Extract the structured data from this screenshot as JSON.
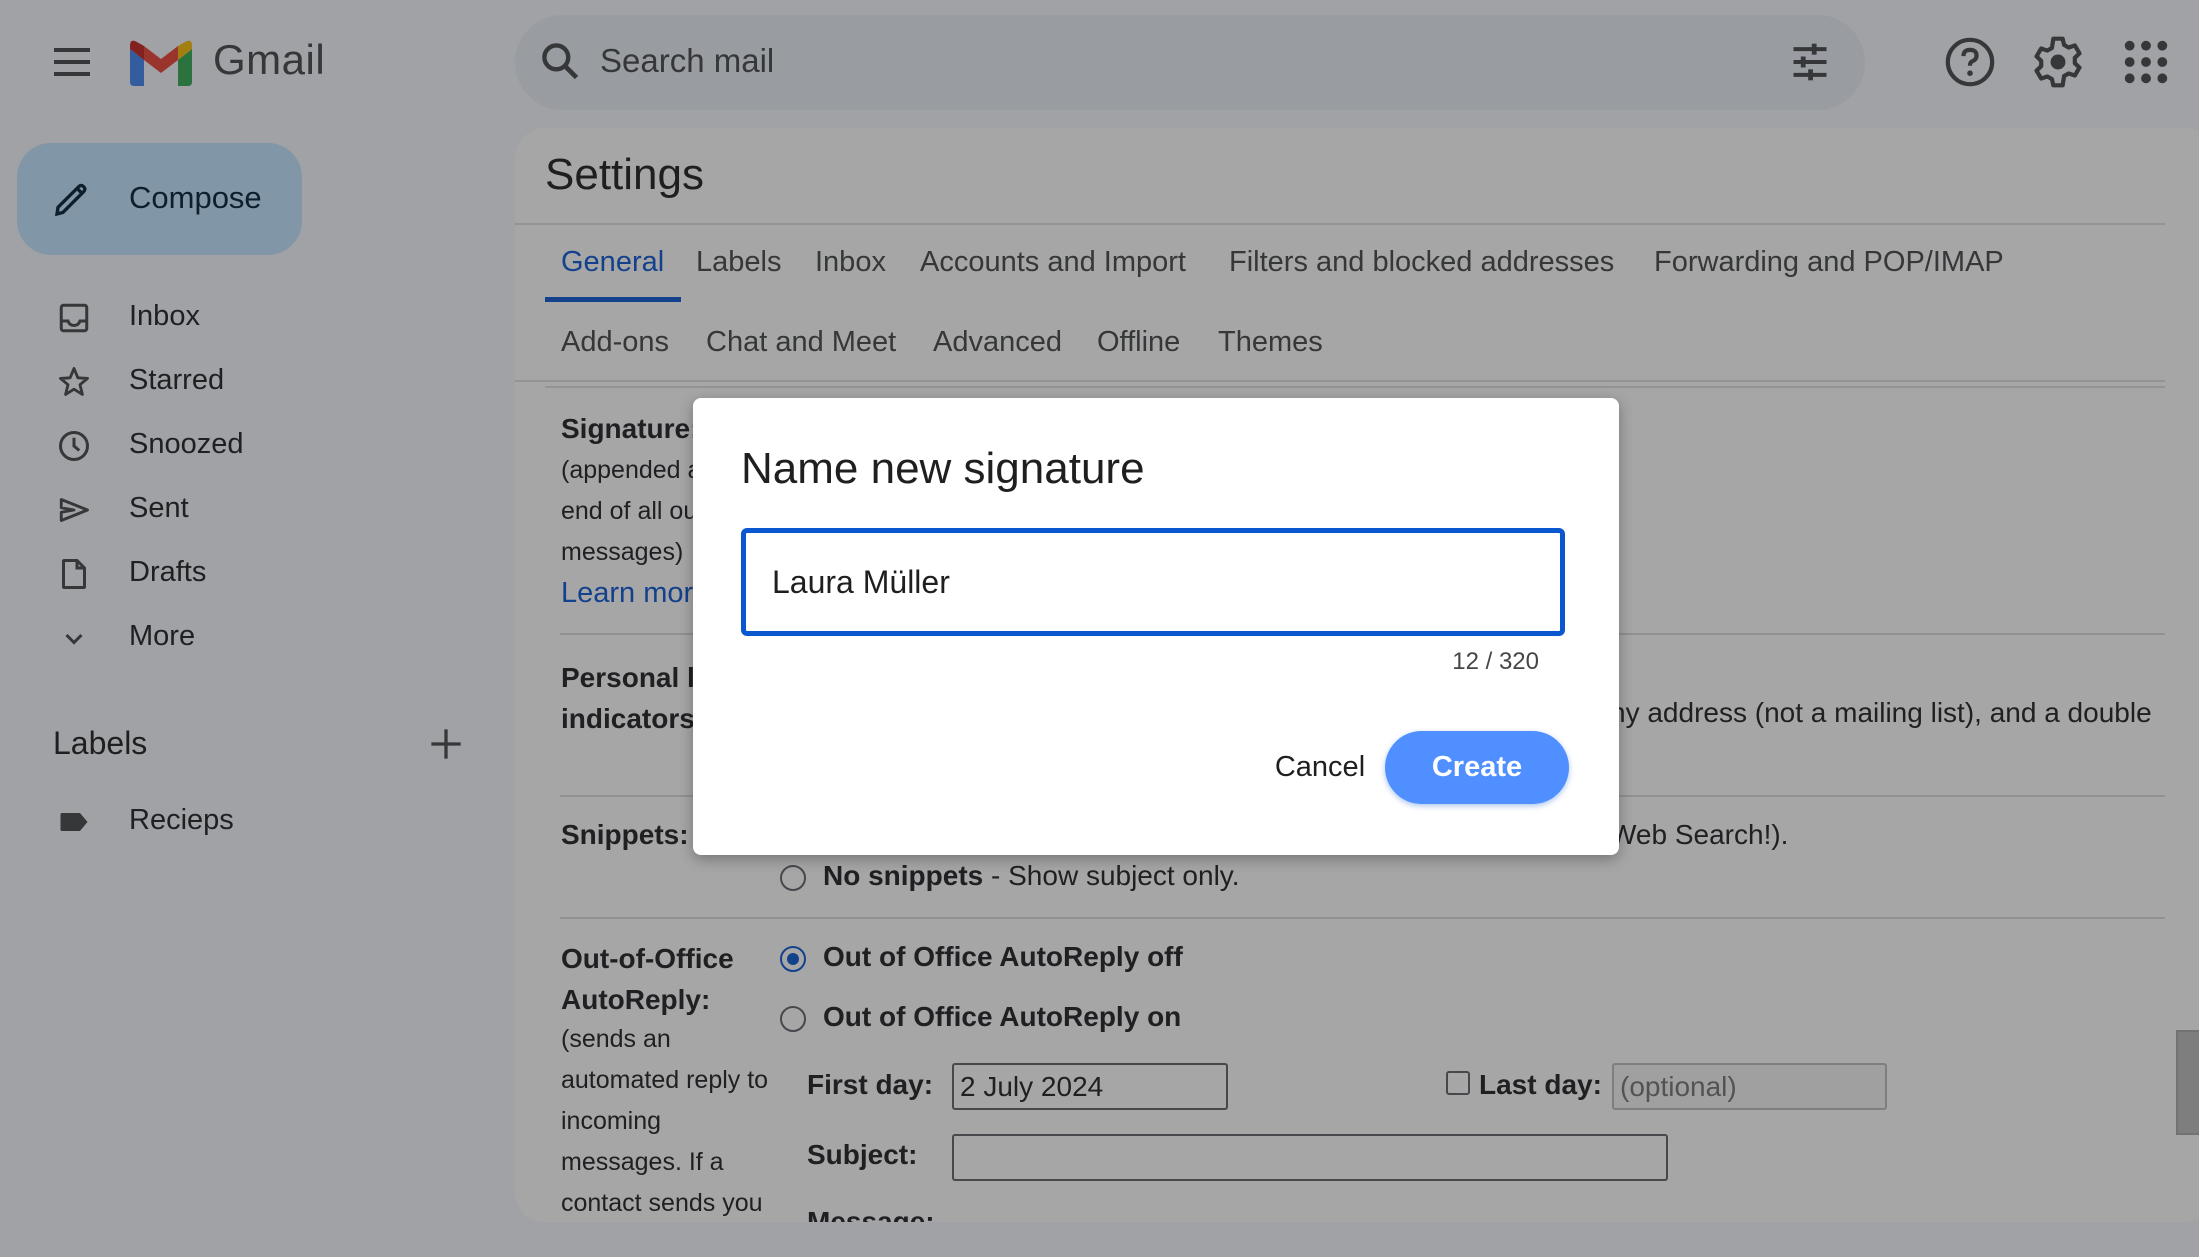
{
  "app": {
    "brand": "Gmail"
  },
  "header": {
    "search_placeholder": "Search mail",
    "icons": [
      "menu-icon",
      "search-icon",
      "search-options-icon",
      "help-icon",
      "settings-gear-icon",
      "apps-grid-icon"
    ]
  },
  "sidebar": {
    "compose_label": "Compose",
    "items": [
      {
        "label": "Inbox",
        "icon": "inbox-icon"
      },
      {
        "label": "Starred",
        "icon": "star-icon"
      },
      {
        "label": "Snoozed",
        "icon": "clock-icon"
      },
      {
        "label": "Sent",
        "icon": "send-icon"
      },
      {
        "label": "Drafts",
        "icon": "draft-icon"
      },
      {
        "label": "More",
        "icon": "chevron-down-icon"
      }
    ],
    "labels_heading": "Labels",
    "labels": [
      {
        "label": "Recieps",
        "icon": "label-icon"
      }
    ]
  },
  "settings": {
    "title": "Settings",
    "tabs_row1": [
      {
        "label": "General",
        "active": true
      },
      {
        "label": "Labels"
      },
      {
        "label": "Inbox"
      },
      {
        "label": "Accounts and Import"
      },
      {
        "label": "Filters and blocked addresses"
      },
      {
        "label": "Forwarding and POP/IMAP"
      }
    ],
    "tabs_row2": [
      {
        "label": "Add-ons"
      },
      {
        "label": "Chat and Meet"
      },
      {
        "label": "Advanced"
      },
      {
        "label": "Offline"
      },
      {
        "label": "Themes"
      }
    ],
    "signature": {
      "label": "Signature:",
      "sub_lines": [
        "(appended at the",
        "end of all outgoing",
        "messages)"
      ],
      "learn_more": "Learn more"
    },
    "personal_indicators": {
      "label_lines": [
        "Personal level",
        "indicators:"
      ],
      "text_visible": "ny address (not a mailing list), and a double"
    },
    "snippets": {
      "label": "Snippets:",
      "text_visible": "Web Search!).",
      "no_snippets_bold": "No snippets",
      "no_snippets_desc": " - Show subject only.",
      "no_snippets_selected": false
    },
    "out_of_office": {
      "label_lines": [
        "Out-of-Office",
        "AutoReply:"
      ],
      "sub_lines": [
        "(sends an",
        "automated reply to",
        "incoming",
        "messages. If a",
        "contact sends you"
      ],
      "option_off": "Out of Office AutoReply off",
      "option_on": "Out of Office AutoReply on",
      "selected": "off",
      "first_day_label": "First day:",
      "first_day_value": "2 July 2024",
      "last_day_label": "Last day:",
      "last_day_placeholder": "(optional)",
      "last_day_checked": false,
      "subject_label": "Subject:",
      "subject_value": "",
      "message_label": "Message:"
    }
  },
  "dialog": {
    "title": "Name new signature",
    "input_value": "Laura Müller",
    "char_count": "12 / 320",
    "cancel_label": "Cancel",
    "create_label": "Create"
  },
  "colors": {
    "accent": "#0b57d0",
    "create_button": "#4f8fff",
    "compose_bg": "#c2e7ff",
    "overlay": "rgba(32,33,36,0.40)"
  }
}
